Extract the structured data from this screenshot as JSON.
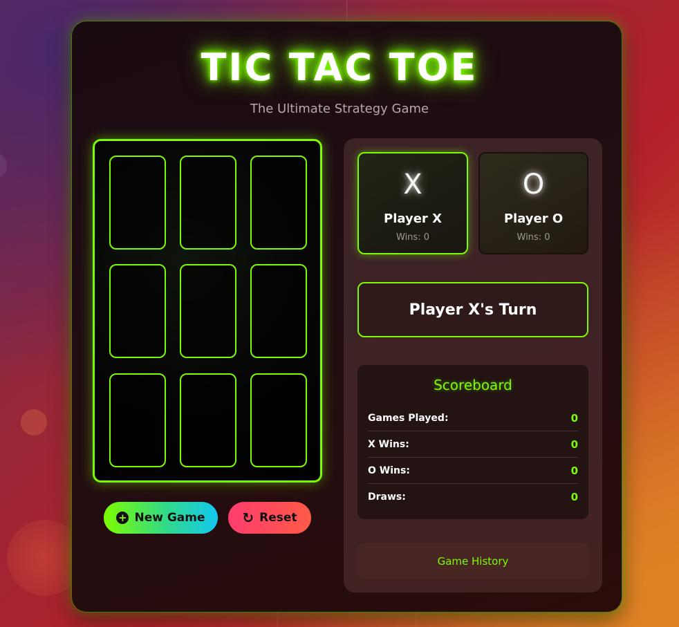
{
  "header": {
    "title": "TIC TAC TOE",
    "subtitle": "The Ultimate Strategy Game"
  },
  "board": {
    "cells": [
      "",
      "",
      "",
      "",
      "",
      "",
      "",
      "",
      ""
    ]
  },
  "buttons": {
    "new_game_label": "New Game",
    "new_game_icon": "plus-circle-icon",
    "reset_label": "Reset",
    "reset_icon": "rotate-icon"
  },
  "players": [
    {
      "symbol": "X",
      "name": "Player X",
      "wins": "Wins: 0",
      "active": true
    },
    {
      "symbol": "O",
      "name": "Player O",
      "wins": "Wins: 0",
      "active": false
    }
  ],
  "status": {
    "turn": "Player X's Turn"
  },
  "scoreboard": {
    "title": "Scoreboard",
    "rows": [
      {
        "label": "Games Played:",
        "value": "0"
      },
      {
        "label": "X Wins:",
        "value": "0"
      },
      {
        "label": "O Wins:",
        "value": "0"
      },
      {
        "label": "Draws:",
        "value": "0"
      }
    ]
  },
  "history": {
    "label": "Game History"
  },
  "colors": {
    "accent": "#7cfc00",
    "reset_gradient_start": "#ff3d6e",
    "new_game_gradient_end": "#12c8f0"
  }
}
